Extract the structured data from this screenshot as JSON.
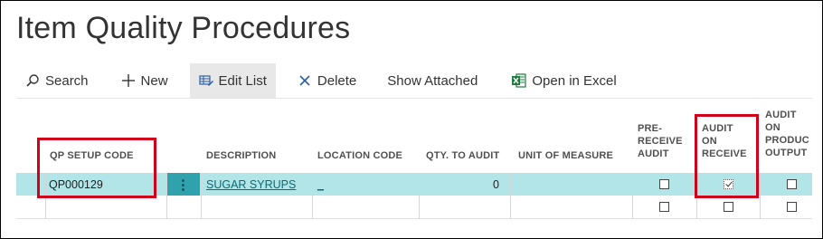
{
  "page": {
    "title": "Item Quality Procedures"
  },
  "toolbar": {
    "search_label": "Search",
    "new_label": "New",
    "edit_list_label": "Edit List",
    "delete_label": "Delete",
    "show_attached_label": "Show Attached",
    "open_excel_label": "Open in Excel"
  },
  "columns": {
    "qp_setup_code": "QP SETUP CODE",
    "description": "DESCRIPTION",
    "location_code": "LOCATION CODE",
    "qty_to_audit": "QTY. TO AUDIT",
    "unit_of_measure": "UNIT OF MEASURE",
    "pre_receive_audit": [
      "PRE-",
      "RECEIVE",
      "AUDIT"
    ],
    "audit_on_receive": [
      "AUDIT",
      "ON",
      "RECEIVE"
    ],
    "audit_on_production_output": [
      "AUDIT",
      "ON",
      "PRODUC",
      "OUTPUT"
    ]
  },
  "rows": [
    {
      "qp_setup_code": "QP000129",
      "description": "SUGAR SYRUPS",
      "location_code": "_",
      "qty_to_audit": "0",
      "unit_of_measure": "",
      "pre_receive_audit": false,
      "audit_on_receive": true,
      "audit_on_production_output": false
    },
    {
      "qp_setup_code": "",
      "description": "",
      "location_code": "",
      "qty_to_audit": "",
      "unit_of_measure": "",
      "pre_receive_audit": false,
      "audit_on_receive": false,
      "audit_on_production_output": false
    }
  ],
  "colors": {
    "selected_row": "#b2e5e8",
    "row_menu": "#2fa2ad",
    "link": "#0b6a74",
    "highlight_box": "#d0021b",
    "excel_green": "#1d7a3e"
  },
  "icons": {
    "search": "search-icon",
    "new": "plus-icon",
    "edit_list": "edit-list-icon",
    "delete": "close-icon",
    "open_excel": "excel-icon",
    "row_menu": "more-vertical-icon"
  }
}
